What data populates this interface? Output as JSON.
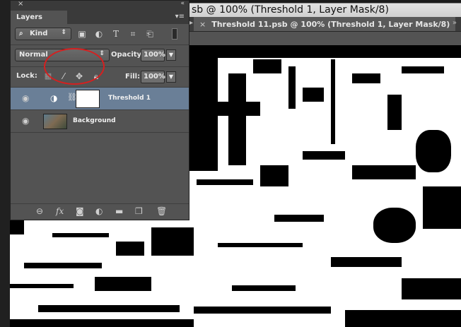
{
  "back_document": {
    "title": "sb @ 100% (Threshold 1, Layer Mask/8)"
  },
  "document": {
    "tab_close": "×",
    "tab_title": "Threshold 11.psb @ 100% (Threshold 1, Layer Mask/8)",
    "tab_overflow": "»"
  },
  "panel": {
    "close": "×",
    "collapse": "«",
    "tab_label": "Layers",
    "menu": "▾≡",
    "filter": {
      "label": "Kind",
      "icon": "search-icon"
    },
    "blend_mode": "Normal",
    "opacity_label": "Opacity:",
    "opacity_value": "100%",
    "lock_label": "Lock:",
    "fill_label": "Fill:",
    "fill_value": "100%",
    "layers": [
      {
        "name": "Threshold 1",
        "selected": true
      },
      {
        "name": "Background",
        "selected": false
      }
    ],
    "bottom_icons": [
      "link-icon",
      "fx-icon",
      "mask-icon",
      "adjustment-icon",
      "folder-icon",
      "new-layer-icon",
      "trash-icon"
    ]
  },
  "colors": {
    "selected_layer": "#6a7f97",
    "highlight_oval": "#d42020",
    "panel_bg": "#535353"
  }
}
